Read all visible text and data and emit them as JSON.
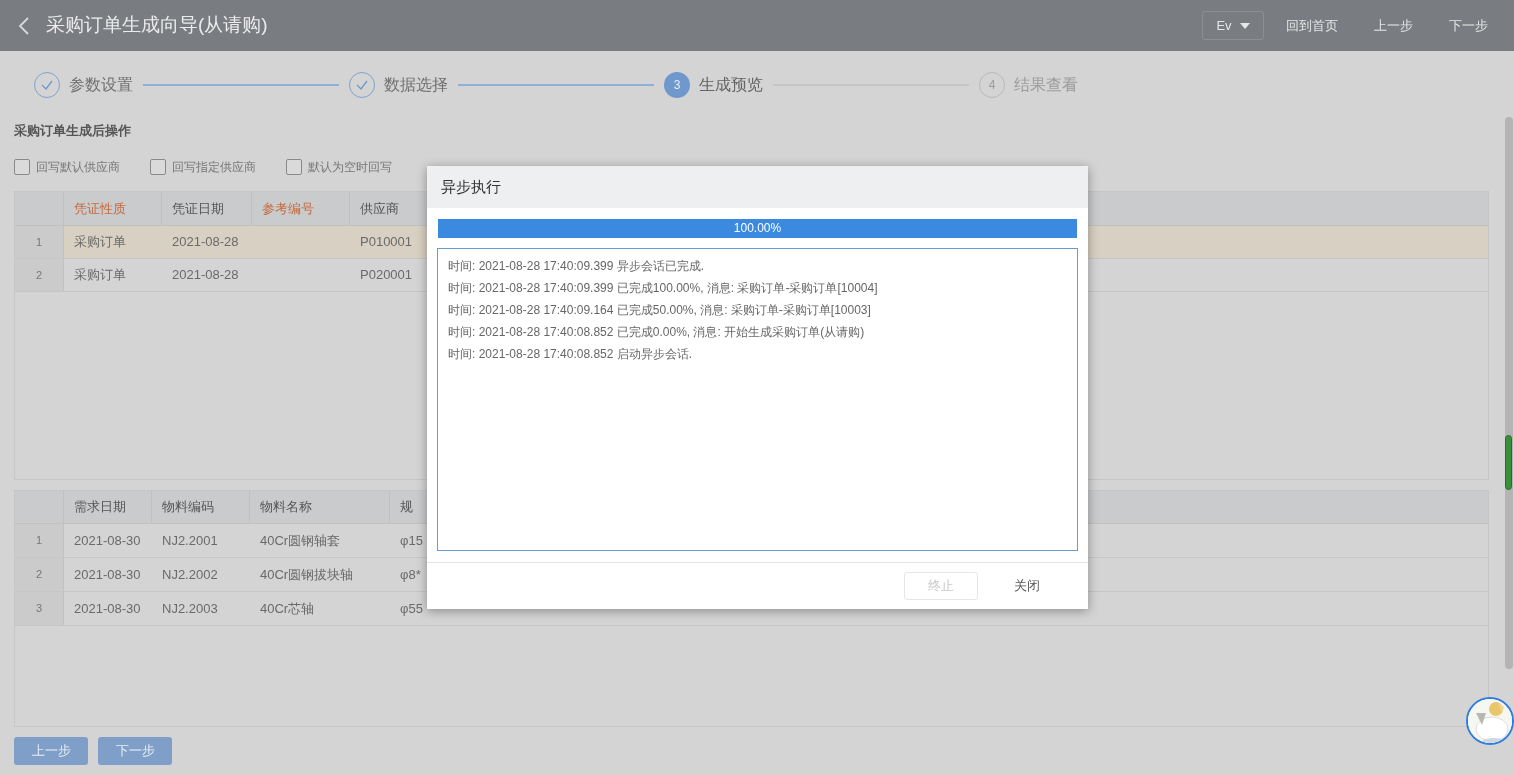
{
  "header": {
    "title": "采购订单生成向导(从请购)",
    "language": "Ev",
    "links": [
      "回到首页",
      "上一步",
      "下一步"
    ]
  },
  "steps": [
    {
      "label": "参数设置",
      "completed": true,
      "current": false
    },
    {
      "label": "数据选择",
      "completed": true,
      "current": false
    },
    {
      "number": "3",
      "label": "生成预览",
      "completed": false,
      "current": true
    },
    {
      "number": "4",
      "label": "结果查看",
      "completed": false,
      "current": false
    }
  ],
  "section_title": "采购订单生成后操作",
  "options": [
    {
      "label": "回写默认供应商",
      "checked": false
    },
    {
      "label": "回写指定供应商",
      "checked": false
    },
    {
      "label": "默认为空时回写",
      "checked": false
    }
  ],
  "orders_table": {
    "columns": [
      {
        "label": "凭证性质",
        "required": true
      },
      {
        "label": "凭证日期",
        "required": false
      },
      {
        "label": "参考编号",
        "required": true
      },
      {
        "label": "供应商",
        "required": false
      }
    ],
    "rows": [
      {
        "index": "1",
        "selected": true,
        "cells": [
          "采购订单",
          "2021-08-28",
          "",
          "P010001"
        ]
      },
      {
        "index": "2",
        "selected": false,
        "cells": [
          "采购订单",
          "2021-08-28",
          "",
          "P020001"
        ]
      }
    ]
  },
  "items_table": {
    "columns": [
      "需求日期",
      "物料编码",
      "物料名称",
      "规"
    ],
    "rows": [
      {
        "index": "1",
        "cells": [
          "2021-08-30",
          "NJ2.2001",
          "40Cr圆钢轴套",
          "φ15"
        ]
      },
      {
        "index": "2",
        "cells": [
          "2021-08-30",
          "NJ2.2002",
          "40Cr圆钢拔块轴",
          "φ8*"
        ]
      },
      {
        "index": "3",
        "cells": [
          "2021-08-30",
          "NJ2.2003",
          "40Cr芯轴",
          "φ55"
        ]
      }
    ]
  },
  "footer_buttons": [
    "上一步",
    "下一步"
  ],
  "dialog": {
    "title": "异步执行",
    "progress": {
      "level": 1,
      "reading": "100.00%"
    },
    "log": [
      "时间: 2021-08-28 17:40:09.399 异步会话已完成.",
      "时间: 2021-08-28 17:40:09.399 已完成100.00%, 消息: 采购订单-采购订单[10004]",
      "时间: 2021-08-28 17:40:09.164 已完成50.00%, 消息: 采购订单-采购订单[10003]",
      "时间: 2021-08-28 17:40:08.852 已完成0.00%, 消息: 开始生成采购订单(从请购)",
      "时间: 2021-08-28 17:40:08.852 启动异步会话."
    ],
    "buttons": [
      {
        "label": "终止",
        "disabled": true
      },
      {
        "label": "关闭",
        "disabled": false
      }
    ]
  }
}
